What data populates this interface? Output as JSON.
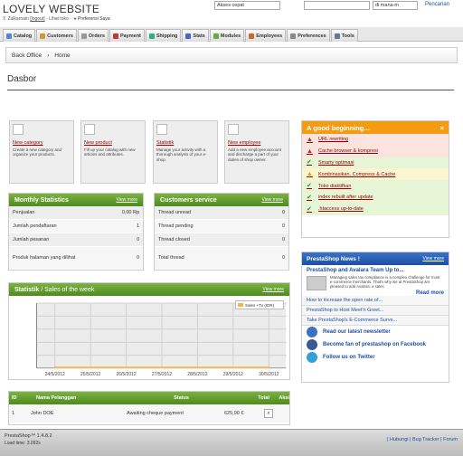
{
  "header": {
    "site_title": "LOVELY WEBSITE",
    "user_name": "Y. Zulkarnain",
    "logout": "[logout]",
    "view_shop": "- Lihat toko -",
    "preferences": "Preferensi Saya",
    "quick_access": "Akses cepat",
    "search_scope": "di mana-m",
    "search_button": "Pencarian"
  },
  "tabs": [
    {
      "label": "Catalog",
      "color": "#4a8bd1"
    },
    {
      "label": "Customers",
      "color": "#d8923a"
    },
    {
      "label": "Orders",
      "color": "#999"
    },
    {
      "label": "Payment",
      "color": "#c33"
    },
    {
      "label": "Shipping",
      "color": "#3a8"
    },
    {
      "label": "Stats",
      "color": "#46c"
    },
    {
      "label": "Modules",
      "color": "#6a4"
    },
    {
      "label": "Employees",
      "color": "#c63"
    },
    {
      "label": "Preferences",
      "color": "#888"
    },
    {
      "label": "Tools",
      "color": "#679"
    }
  ],
  "breadcrumb": {
    "root": "Back Office",
    "current": "Home"
  },
  "page_title": "Dasbor",
  "quick_links": [
    {
      "title": "New category",
      "desc": "Create a new category and organize your products."
    },
    {
      "title": "New product",
      "desc": "Fill up your catalog with new articles and attributes."
    },
    {
      "title": "Statistik",
      "desc": "Manage your activity with a thorough analysis of your e-shop."
    },
    {
      "title": "New employee",
      "desc": "Add a new employee account and discharge a part of your duties of shop owner."
    }
  ],
  "monthly": {
    "title": "Monthly Statistics",
    "view_more": "View more",
    "rows": [
      {
        "label": "Penjualan",
        "value": "0,00 Rp"
      },
      {
        "label": "Jumlah pendaftaran",
        "value": "1"
      },
      {
        "label": "Jumlah pesanan",
        "value": "0"
      },
      {
        "label": "Produk halaman yang dilihat",
        "value": "0"
      }
    ]
  },
  "service": {
    "title": "Customers service",
    "view_more": "View more",
    "rows": [
      {
        "label": "Thread unread",
        "value": "0"
      },
      {
        "label": "Thread pending",
        "value": "0"
      },
      {
        "label": "Thread closed",
        "value": "0"
      },
      {
        "label": "Total thread",
        "value": "0"
      }
    ]
  },
  "good": {
    "title": "A good beginning...",
    "close": "×",
    "items": [
      {
        "label": "URL rewriting",
        "status": "err"
      },
      {
        "label": "Cache browser & kompresi",
        "status": "err"
      },
      {
        "label": "Smarty optimasi",
        "status": "ok"
      },
      {
        "label": "Kombinasikan, Compress & Cache",
        "status": "warn"
      },
      {
        "label": "Toko diaktifkan",
        "status": "ok"
      },
      {
        "label": "index rebuilt after update",
        "status": "ok"
      },
      {
        "label": ".htaccess up-to-date",
        "status": "ok"
      }
    ]
  },
  "news": {
    "title": "PrestaShop News !",
    "view_more": "View more",
    "headline": "PrestaShop and Avalara Team Up to...",
    "summary": "Managing sales tax compliance is a complex challenge for most e-commerce merchants. That's why we at PrestaShop are pleased to add Avalara, a sales",
    "read_more": "Read more",
    "links": [
      "How to increase the open rate of...",
      "PrestaShop to Host Meet'n Greet...",
      "Take PrestaShop's E-Commerce Surve..."
    ],
    "social": [
      {
        "label": "Read our latest newsletter",
        "color": "#3a73c6"
      },
      {
        "label": "Become fan of prestashop on Facebook",
        "color": "#3b5998"
      },
      {
        "label": "Follow us on Twitter",
        "color": "#33a0d8"
      }
    ]
  },
  "stats": {
    "title": "Statistik",
    "subtitle": "/ Sales of the week",
    "view_more": "View more",
    "legend": "Sales +Tx (IDR)"
  },
  "chart_data": {
    "type": "line",
    "x": [
      "24/5/2012",
      "25/5/2012",
      "26/5/2012",
      "27/5/2012",
      "28/5/2012",
      "29/5/2012",
      "30/5/2012"
    ],
    "series": [
      {
        "name": "Sales +Tx (IDR)",
        "values": [
          0,
          0,
          0,
          0,
          0,
          0,
          0
        ]
      }
    ],
    "y_ticks": [
      "1",
      "0.8",
      "0.6",
      "0.4",
      "0.2",
      "0"
    ],
    "ylim": [
      0,
      1
    ],
    "legend": "top-right",
    "color": "#f5b53f"
  },
  "orders": {
    "headers": [
      "ID",
      "Nama Pelanggan",
      "Status",
      "Total",
      "Aksi"
    ],
    "rows": [
      {
        "id": "1",
        "customer": "John DOE",
        "status": "Awaiting cheque payment",
        "total": "625,90 €"
      }
    ]
  },
  "footer": {
    "version": "PrestaShop™ 1.4.8.2",
    "load_time": "Load time: 3.092s",
    "links": "| Hubungi | Bug Tracker | Forum"
  }
}
